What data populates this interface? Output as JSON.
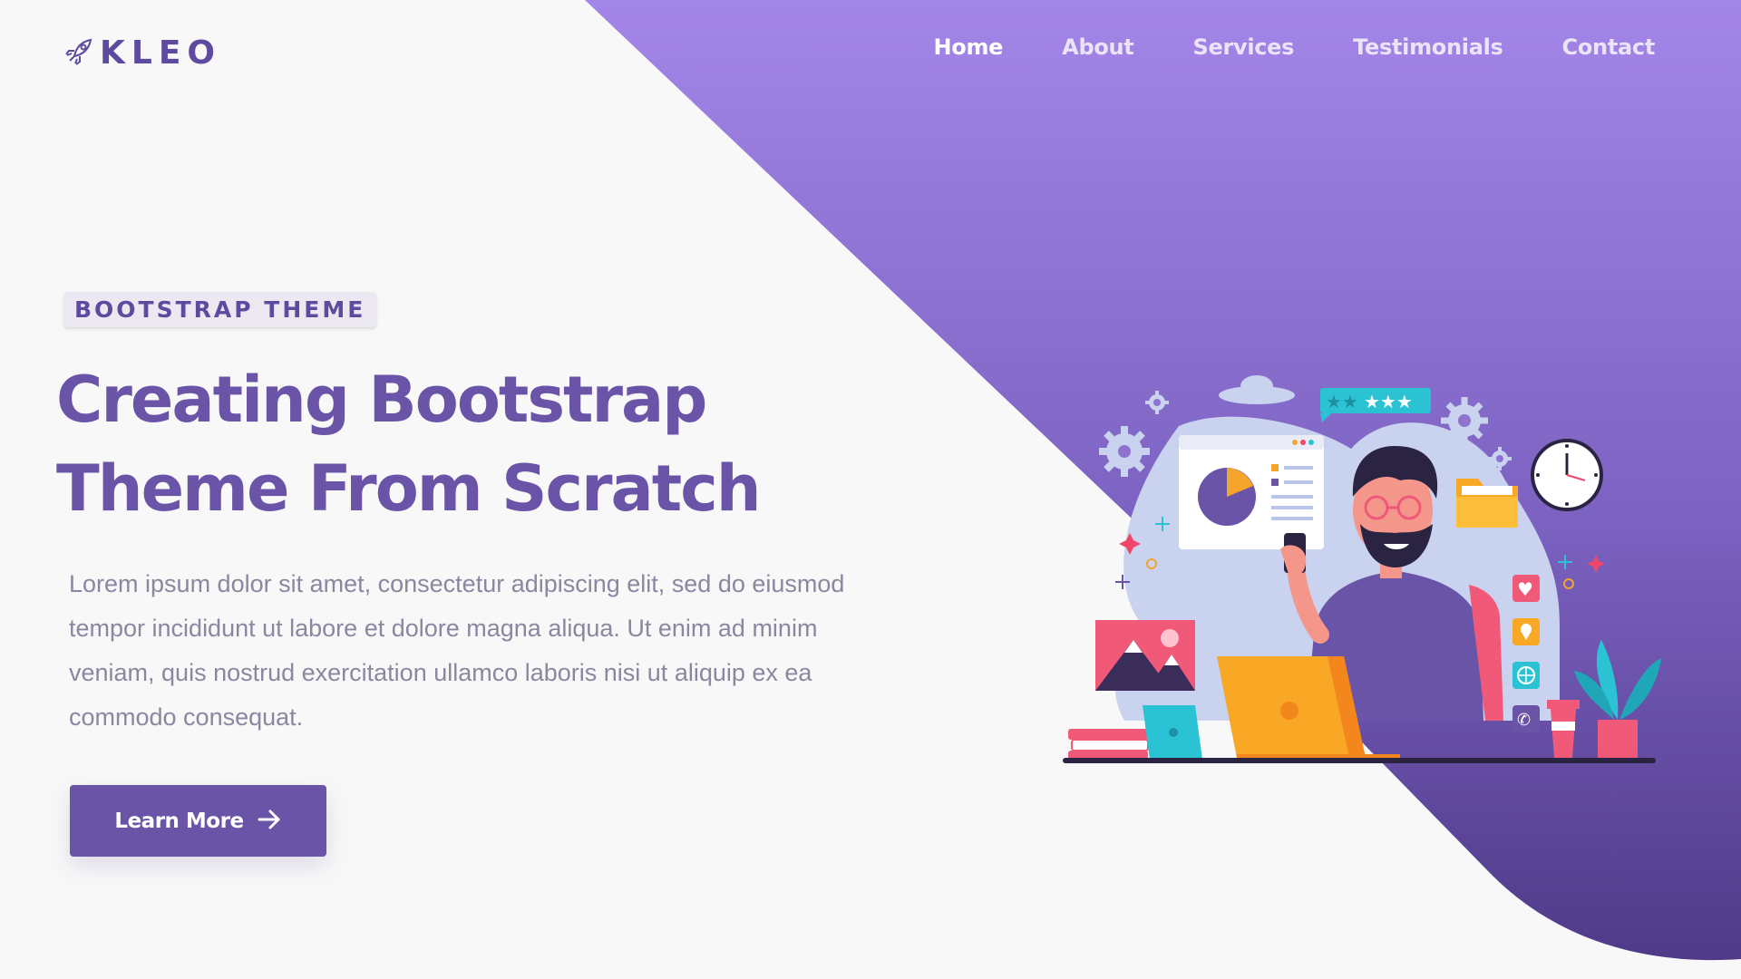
{
  "brand": {
    "name": "KLEO",
    "logo_icon": "rocket-icon"
  },
  "nav": {
    "items": [
      {
        "label": "Home",
        "active": true
      },
      {
        "label": "About",
        "active": false
      },
      {
        "label": "Services",
        "active": false
      },
      {
        "label": "Testimonials",
        "active": false
      },
      {
        "label": "Contact",
        "active": false
      }
    ]
  },
  "hero": {
    "badge": "BOOTSTRAP THEME",
    "title_line1": "Creating Bootstrap",
    "title_line2": "Theme From Scratch",
    "description": "Lorem ipsum dolor sit amet, consectetur adipiscing elit, sed do eiusmod tempor incididunt ut labore et dolore magna aliqua. Ut enim ad minim veniam, quis nostrud exercitation ullamco laboris nisi ut aliquip ex ea commodo consequat.",
    "cta_label": "Learn More",
    "cta_icon": "arrow-right-icon"
  },
  "colors": {
    "primary": "#6a54a8",
    "gradient_top": "#a386e8",
    "gradient_bottom": "#4f3a88",
    "background": "#f8f8f8",
    "text_muted": "#8a87a0"
  },
  "illustration": {
    "rating_stars": 5,
    "filled_stars": 3
  }
}
